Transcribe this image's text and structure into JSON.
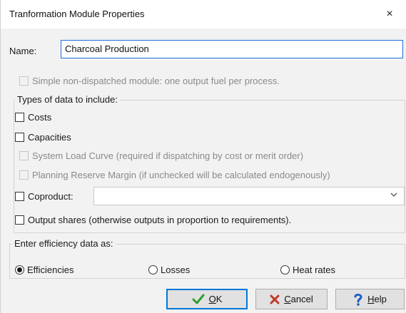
{
  "window": {
    "title": "Tranformation Module Properties",
    "close_glyph": "×"
  },
  "name": {
    "label": "Name:",
    "value": "Charcoal Production"
  },
  "simple_option": {
    "label": "Simple non-dispatched module: one output fuel per process.",
    "checked": false,
    "enabled": false
  },
  "types_group": {
    "label": "Types of data to include:",
    "options": {
      "costs": {
        "label": "Costs",
        "checked": false,
        "enabled": true
      },
      "capacities": {
        "label": "Capacities",
        "checked": false,
        "enabled": true
      },
      "load_curve": {
        "label": "System Load Curve (required if dispatching by cost or merit order)",
        "checked": false,
        "enabled": false
      },
      "reserve_margin": {
        "label": "Planning Reserve Margin (if unchecked will be calculated endogenously)",
        "checked": false,
        "enabled": false
      },
      "coproduct": {
        "label": "Coproduct:",
        "checked": false,
        "enabled": true,
        "selected_value": ""
      },
      "output_shares": {
        "label": "Output shares (otherwise outputs in proportion to requirements).",
        "checked": false,
        "enabled": true
      }
    }
  },
  "efficiency_group": {
    "label": "Enter efficiency data as:",
    "options": [
      {
        "label": "Efficiencies",
        "selected": true
      },
      {
        "label": "Losses",
        "selected": false
      },
      {
        "label": "Heat rates",
        "selected": false
      }
    ]
  },
  "buttons": {
    "ok": {
      "mnemonic": "O",
      "rest": "K",
      "icon": "checkmark-icon",
      "color": "#2e9d2e"
    },
    "cancel": {
      "mnemonic": "C",
      "rest": "ancel",
      "icon": "x-icon",
      "color": "#c0392b"
    },
    "help": {
      "mnemonic": "H",
      "rest": "elp",
      "icon": "question-icon",
      "color": "#1e5fbf"
    }
  }
}
